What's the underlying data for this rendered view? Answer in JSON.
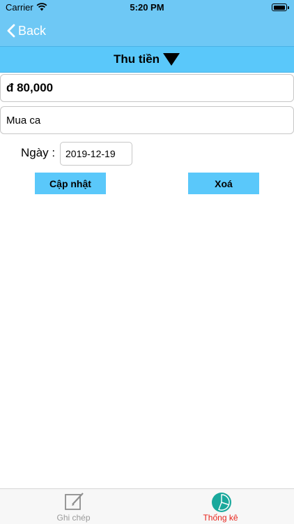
{
  "status_bar": {
    "carrier": "Carrier",
    "time": "5:20 PM",
    "battery_level": 0.95,
    "icons": [
      "wifi-icon",
      "battery-icon"
    ]
  },
  "nav": {
    "back_label": "Back",
    "icons": [
      "chevron-left-icon"
    ]
  },
  "type_selector": {
    "label": "Thu tiền",
    "icons": [
      "triangle-down-icon"
    ]
  },
  "form": {
    "amount": "đ 80,000",
    "note": "Mua ca",
    "date_label": "Ngày :",
    "date_value": "2019-12-19"
  },
  "actions": {
    "update_label": "Cập nhật",
    "delete_label": "Xoá"
  },
  "tabs": [
    {
      "label": "Ghi chép",
      "icon": "edit-note-icon",
      "active": false
    },
    {
      "label": "Thống kê",
      "icon": "pie-chart-icon",
      "active": true
    }
  ],
  "colors": {
    "nav_background": "#6ec8f5",
    "accent": "#5ac8fa",
    "active_tab": "#e8231a",
    "inactive_tab": "#9a9a9a",
    "pie_icon": "#19a89c"
  }
}
